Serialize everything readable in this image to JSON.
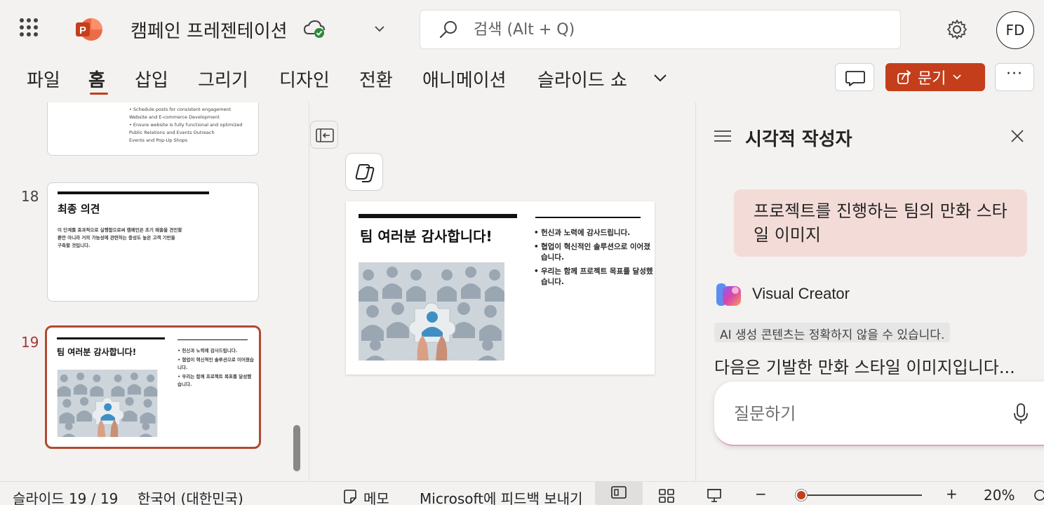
{
  "app": {
    "document_title": "캠페인 프레젠테이션",
    "brand_color": "#c43e1c"
  },
  "search": {
    "placeholder": "검색 (Alt + Q)"
  },
  "user": {
    "initials": "FD"
  },
  "ribbon": {
    "tabs": [
      "파일",
      "홈",
      "삽입",
      "그리기",
      "디자인",
      "전환",
      "애니메이션",
      "슬라이드 쇼"
    ],
    "active_tab": "홈",
    "share_label": "문기",
    "more_label": "···"
  },
  "thumbnails": {
    "slide17_lines": [
      "•   Schedule posts for consistent engagement",
      "Website and E-commerce Development",
      "•   Ensure website is fully functional and optimized",
      "Public Relations and Events Outreach",
      "Events and Pop-Up Shops"
    ],
    "slide18": {
      "number": "18",
      "title": "최종 의견",
      "body_lines": [
        "이 단계를 효과적으로 실행함으로써 캠페인은 초기 매출을 견인할",
        "뿐만 아니라 거의 가능성에 관련하는 충성도 높은 고객 기반을",
        "구축할 것입니다."
      ]
    },
    "slide19": {
      "number": "19",
      "title": "팀 여러분 감사합니다!",
      "bullets": [
        "헌신과 노력에 감사드립니다.",
        "협업이 혁신적인 솔루션으로 이어졌습니다.",
        "우리는 함께 프로젝트 목표를 달성했습니다."
      ]
    }
  },
  "slide": {
    "title": "팀 여러분 감사합니다!",
    "bullets": [
      "헌신과 노력에 감사드립니다.",
      "협업이 혁신적인 솔루션으로 이어졌습니다.",
      "우리는 함께 프로젝트 목표를 달성했습니다."
    ]
  },
  "visual_creator": {
    "pane_title": "시각적 작성자",
    "user_prompt": "프로젝트를 진행하는 팀의 만화 스타일 이미지",
    "assistant_name": "Visual Creator",
    "ai_disclaimer": "AI 생성 콘텐츠는 정확하지 않을 수 있습니다.",
    "response": "다음은 기발한 만화 스타일 이미지입니다...",
    "ask_placeholder": "질문하기",
    "bubble_color": "#f3dcd8"
  },
  "status": {
    "slide_counter": "슬라이드 19 / 19",
    "language": "한국어 (대한민국)",
    "notes_label": "메모",
    "feedback_label": "Microsoft에 피드백 보내기",
    "zoom_minus": "−",
    "zoom_plus": "+",
    "zoom_level": "20%",
    "zoom_fraction": 0.2
  }
}
